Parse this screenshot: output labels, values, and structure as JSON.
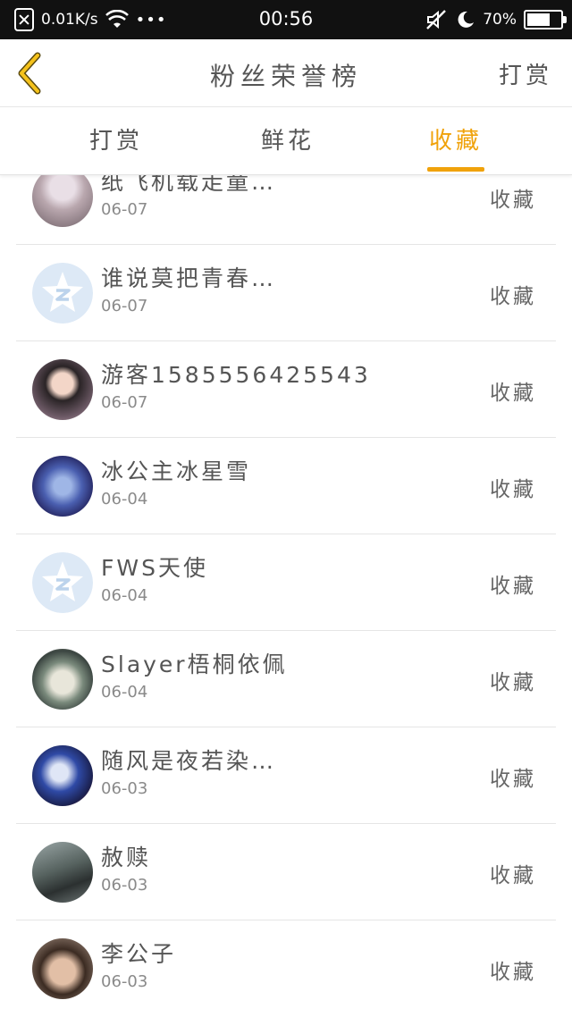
{
  "status_bar": {
    "speed": "0.01K/s",
    "more": "•••",
    "time": "00:56",
    "battery_text": "70%",
    "battery_level": 0.7
  },
  "nav": {
    "title": "粉丝荣誉榜",
    "right_action": "打赏",
    "back_icon": "chevron-left-icon",
    "accent_color": "#f0a20a"
  },
  "tabs": [
    {
      "label": "打赏",
      "active": false
    },
    {
      "label": "鲜花",
      "active": false
    },
    {
      "label": "收藏",
      "active": true
    }
  ],
  "rows": [
    {
      "name": "纸飞机载走童…",
      "date": "06-07",
      "action": "收藏",
      "avatar": "photo-avatar"
    },
    {
      "name": "谁说莫把青春…",
      "date": "06-07",
      "action": "收藏",
      "avatar": "default-star-avatar"
    },
    {
      "name": "游客1585556425543",
      "date": "06-07",
      "action": "收藏",
      "avatar": "photo-avatar"
    },
    {
      "name": "冰公主冰星雪",
      "date": "06-04",
      "action": "收藏",
      "avatar": "photo-avatar"
    },
    {
      "name": "FWS天使",
      "date": "06-04",
      "action": "收藏",
      "avatar": "default-star-avatar"
    },
    {
      "name": "Slayer梧桐依佩",
      "date": "06-04",
      "action": "收藏",
      "avatar": "photo-avatar"
    },
    {
      "name": "随风是夜若染…",
      "date": "06-03",
      "action": "收藏",
      "avatar": "photo-avatar"
    },
    {
      "name": "赦赎",
      "date": "06-03",
      "action": "收藏",
      "avatar": "photo-avatar"
    },
    {
      "name": "李公子",
      "date": "06-03",
      "action": "收藏",
      "avatar": "photo-avatar"
    }
  ]
}
